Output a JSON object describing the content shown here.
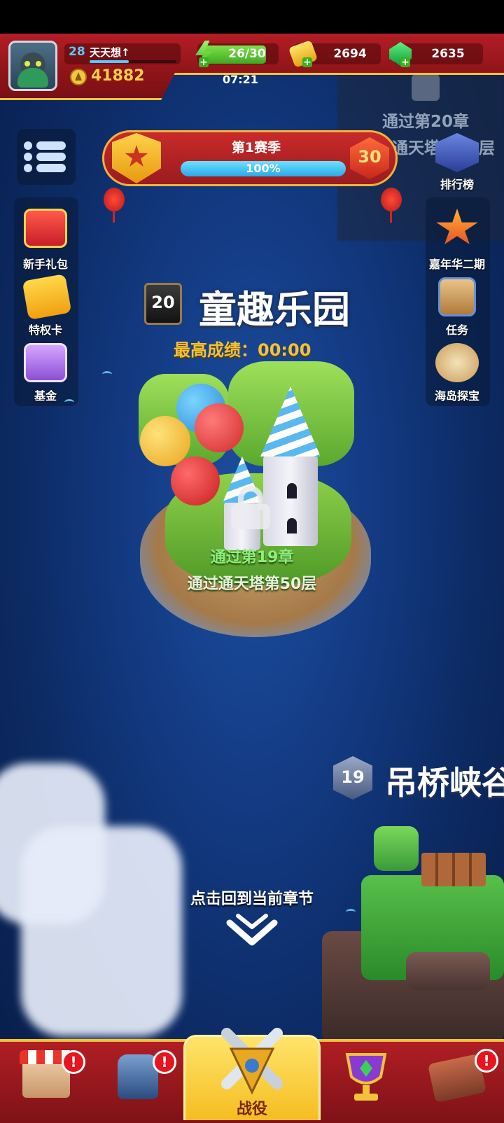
{
  "player": {
    "level": "28",
    "name": "天天想↑",
    "xp_fraction": 0.45,
    "power": "41882"
  },
  "resources": {
    "energy": "26/30",
    "energy_fraction": 0.867,
    "timer": "07:21",
    "gold": "2694",
    "gems": "2635",
    "plus_glyph": "+"
  },
  "season": {
    "title": "第1赛季",
    "progress_text": "100%",
    "progress_fraction": 1.0,
    "level": "30"
  },
  "left_menu": {
    "items": [
      {
        "label": "新手礼包",
        "icon": "gift-box-icon"
      },
      {
        "label": "特权卡",
        "icon": "privilege-card-icon"
      },
      {
        "label": "基金",
        "icon": "treasure-chest-icon"
      }
    ]
  },
  "right_menu": {
    "items": [
      {
        "label": "排行榜",
        "icon": "trophy-rank-icon"
      },
      {
        "label": "嘉年华二期",
        "icon": "star-medal-icon"
      },
      {
        "label": "任务",
        "icon": "task-clipboard-icon"
      },
      {
        "label": "海岛探宝",
        "icon": "island-dice-icon"
      }
    ]
  },
  "background_locked": {
    "line1": "通过第20章",
    "line2": "通天塔第50层"
  },
  "chapter": {
    "number": "20",
    "title": "童趣乐园",
    "best_score": "最高成绩：00:00",
    "unlock_req_1": "通过第19章",
    "unlock_req_2": "通过通天塔第50层",
    "locked": true
  },
  "next_chapter": {
    "number": "19",
    "title": "吊桥峡谷"
  },
  "return_hint": "点击回到当前章节",
  "bottom_nav": {
    "items": [
      {
        "name": "shop",
        "icon": "shop-icon",
        "alert": "!"
      },
      {
        "name": "equipment",
        "icon": "armor-icon",
        "alert": "!"
      },
      {
        "name": "battle",
        "label": "战役",
        "icon": "crossed-swords-icon",
        "active": true
      },
      {
        "name": "rewards",
        "icon": "trophy-cup-icon"
      },
      {
        "name": "workshop",
        "icon": "toolbox-icon",
        "alert": "!"
      }
    ]
  },
  "colors": {
    "top_bar": "#b31e25",
    "accent_gold": "#f2c23a",
    "energy_green": "#3ea920",
    "unlock_green": "#8ef07a",
    "alert_red": "#e8141e"
  }
}
